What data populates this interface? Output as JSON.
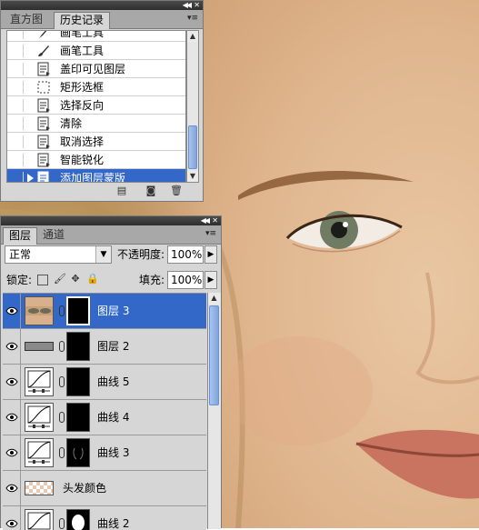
{
  "history_panel": {
    "tabs": [
      {
        "label": "直方图",
        "active": false
      },
      {
        "label": "历史记录",
        "active": true
      }
    ],
    "items": [
      {
        "label": "画笔工具",
        "icon": "brush-icon",
        "selected": false,
        "partial": true
      },
      {
        "label": "画笔工具",
        "icon": "brush-icon",
        "selected": false
      },
      {
        "label": "盖印可见图层",
        "icon": "document-icon",
        "selected": false
      },
      {
        "label": "矩形选框",
        "icon": "marquee-icon",
        "selected": false
      },
      {
        "label": "选择反向",
        "icon": "document-icon",
        "selected": false
      },
      {
        "label": "清除",
        "icon": "document-icon",
        "selected": false
      },
      {
        "label": "取消选择",
        "icon": "document-icon",
        "selected": false
      },
      {
        "label": "智能锐化",
        "icon": "document-icon",
        "selected": false
      },
      {
        "label": "添加图层蒙版",
        "icon": "document-icon",
        "selected": true
      }
    ],
    "footer_buttons": [
      "new-document-from-state-icon",
      "snapshot-icon",
      "trash-icon"
    ]
  },
  "layers_panel": {
    "tabs": [
      {
        "label": "图层",
        "active": true
      },
      {
        "label": "通道",
        "active": false
      }
    ],
    "blend_mode": "正常",
    "opacity_label": "不透明度:",
    "opacity_value": "100%",
    "lock_label": "锁定:",
    "fill_label": "填充:",
    "fill_value": "100%",
    "layers": [
      {
        "name": "图层 3",
        "thumb": "eye-photo",
        "has_mask": true,
        "selected": true
      },
      {
        "name": "图层 2",
        "thumb": "gray",
        "has_mask": true,
        "selected": false
      },
      {
        "name": "曲线 5",
        "thumb": "curves",
        "has_mask": true,
        "selected": false
      },
      {
        "name": "曲线 4",
        "thumb": "curves",
        "has_mask": true,
        "selected": false
      },
      {
        "name": "曲线 3",
        "thumb": "curves",
        "has_mask": true,
        "selected": false
      },
      {
        "name": "头发颜色",
        "thumb": "transparent",
        "has_mask": false,
        "selected": false
      },
      {
        "name": "曲线 2",
        "thumb": "curves",
        "has_mask": true,
        "selected": false
      }
    ]
  },
  "colors": {
    "selection": "#3368c8",
    "panel_bg": "#d6d6d6",
    "titlebar": "#2e2e2e"
  }
}
